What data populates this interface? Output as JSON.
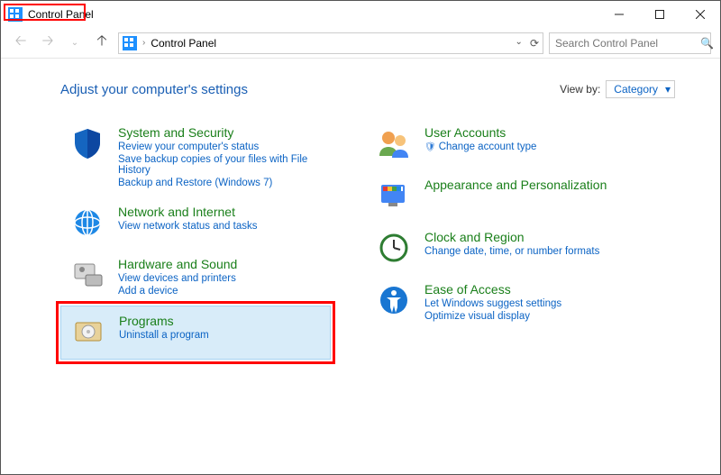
{
  "window": {
    "title": "Control Panel",
    "min_tip": "Minimize",
    "max_tip": "Maximize",
    "close_tip": "Close"
  },
  "address": {
    "location": "Control Panel"
  },
  "search": {
    "placeholder": "Search Control Panel"
  },
  "content": {
    "heading": "Adjust your computer's settings",
    "viewby_label": "View by:",
    "viewby_value": "Category"
  },
  "left_col": [
    {
      "id": "system-security",
      "title": "System and Security",
      "links": [
        "Review your computer's status",
        "Save backup copies of your files with File History",
        "Backup and Restore (Windows 7)"
      ],
      "icon_color": "#1565c0"
    },
    {
      "id": "network",
      "title": "Network and Internet",
      "links": [
        "View network status and tasks"
      ],
      "icon_color": "#1e88e5"
    },
    {
      "id": "hardware",
      "title": "Hardware and Sound",
      "links": [
        "View devices and printers",
        "Add a device"
      ],
      "icon_color": "#8d8d8d"
    },
    {
      "id": "programs",
      "title": "Programs",
      "links": [
        "Uninstall a program"
      ],
      "icon_color": "#c9a24a",
      "selected": true
    }
  ],
  "right_col": [
    {
      "id": "user-accounts",
      "title": "User Accounts",
      "links": [
        "Change account type"
      ],
      "shield_links": [
        0
      ],
      "icon_color": "#e67e22"
    },
    {
      "id": "appearance",
      "title": "Appearance and Personalization",
      "links": [],
      "icon_color": "#4285f4"
    },
    {
      "id": "clock",
      "title": "Clock and Region",
      "links": [
        "Change date, time, or number formats"
      ],
      "icon_color": "#2e7d32"
    },
    {
      "id": "ease",
      "title": "Ease of Access",
      "links": [
        "Let Windows suggest settings",
        "Optimize visual display"
      ],
      "icon_color": "#1976d2"
    }
  ]
}
